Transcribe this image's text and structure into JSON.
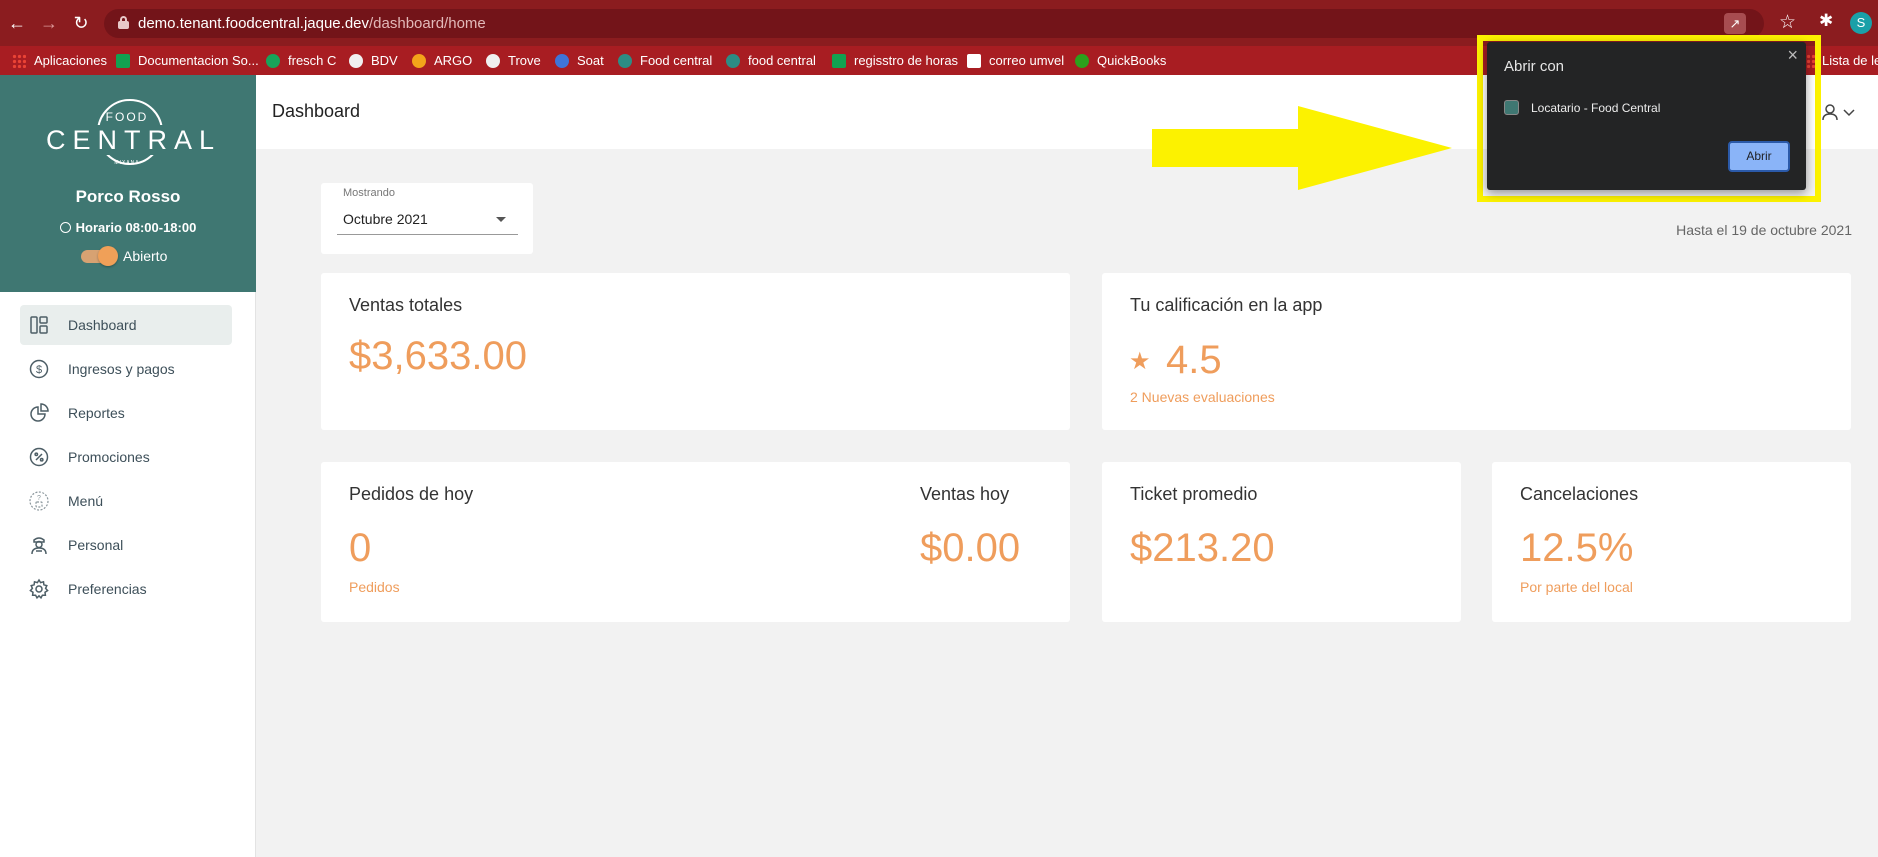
{
  "browser": {
    "url_host": "demo.tenant.foodcentral.jaque.dev",
    "url_path": "/dashboard/home",
    "profile_initial": "S",
    "bookmarks": [
      {
        "label": "Aplicaciones",
        "icon": "apps-grid-icon"
      },
      {
        "label": "Documentacion So...",
        "icon": "sheets-icon"
      },
      {
        "label": "fresch C",
        "icon": "headset-icon"
      },
      {
        "label": "BDV",
        "icon": "globe-icon"
      },
      {
        "label": "ARGO",
        "icon": "argo-icon"
      },
      {
        "label": "Trove",
        "icon": "globe-icon"
      },
      {
        "label": "Soat",
        "icon": "soat-icon"
      },
      {
        "label": "Food central",
        "icon": "foodcentral-icon"
      },
      {
        "label": "food central",
        "icon": "foodcentral-icon"
      },
      {
        "label": "regisstro de horas",
        "icon": "sheets-icon"
      },
      {
        "label": "correo umvel",
        "icon": "gmail-icon"
      },
      {
        "label": "QuickBooks",
        "icon": "quickbooks-icon"
      },
      {
        "label": "Lista de lec",
        "icon": "reading-list-icon"
      }
    ]
  },
  "sidebar": {
    "logo": {
      "top": "FOOD",
      "main": "CENTRAL",
      "bottom": "MIXANA"
    },
    "store_name": "Porco Rosso",
    "hours": "Horario 08:00-18:00",
    "status_label": "Abierto",
    "status_open": true,
    "items": [
      {
        "label": "Dashboard",
        "icon": "dashboard-icon",
        "active": true
      },
      {
        "label": "Ingresos y pagos",
        "icon": "dollar-circle-icon",
        "active": false
      },
      {
        "label": "Reportes",
        "icon": "pie-chart-icon",
        "active": false
      },
      {
        "label": "Promociones",
        "icon": "percent-circle-icon",
        "active": false
      },
      {
        "label": "Menú",
        "icon": "menu-food-icon",
        "active": false
      },
      {
        "label": "Personal",
        "icon": "staff-icon",
        "active": false
      },
      {
        "label": "Preferencias",
        "icon": "gear-icon",
        "active": false
      }
    ]
  },
  "header": {
    "title": "Dashboard"
  },
  "filter": {
    "label": "Mostrando",
    "value": "Octubre 2021"
  },
  "date_note": "Hasta el 19 de octubre 2021",
  "cards": {
    "ventas_totales": {
      "title": "Ventas totales",
      "value": "$3,633.00"
    },
    "calificacion": {
      "title": "Tu calificación en la app",
      "value": "4.5",
      "sub": "2 Nuevas evaluaciones"
    },
    "pedidos_hoy": {
      "title": "Pedidos de hoy",
      "value": "0",
      "sub": "Pedidos"
    },
    "ventas_hoy": {
      "title": "Ventas hoy",
      "value": "$0.00"
    },
    "ticket": {
      "title": "Ticket promedio",
      "value": "$213.20"
    },
    "cancelaciones": {
      "title": "Cancelaciones",
      "value": "12.5%",
      "sub": "Por parte del local"
    }
  },
  "popup": {
    "title": "Abrir con",
    "app_name": "Locatario - Food Central",
    "button": "Abrir"
  },
  "colors": {
    "accent": "#ef9d5c",
    "sidebar_header": "#3f7772",
    "chrome": "#a81d22",
    "highlight": "#fcf200"
  }
}
